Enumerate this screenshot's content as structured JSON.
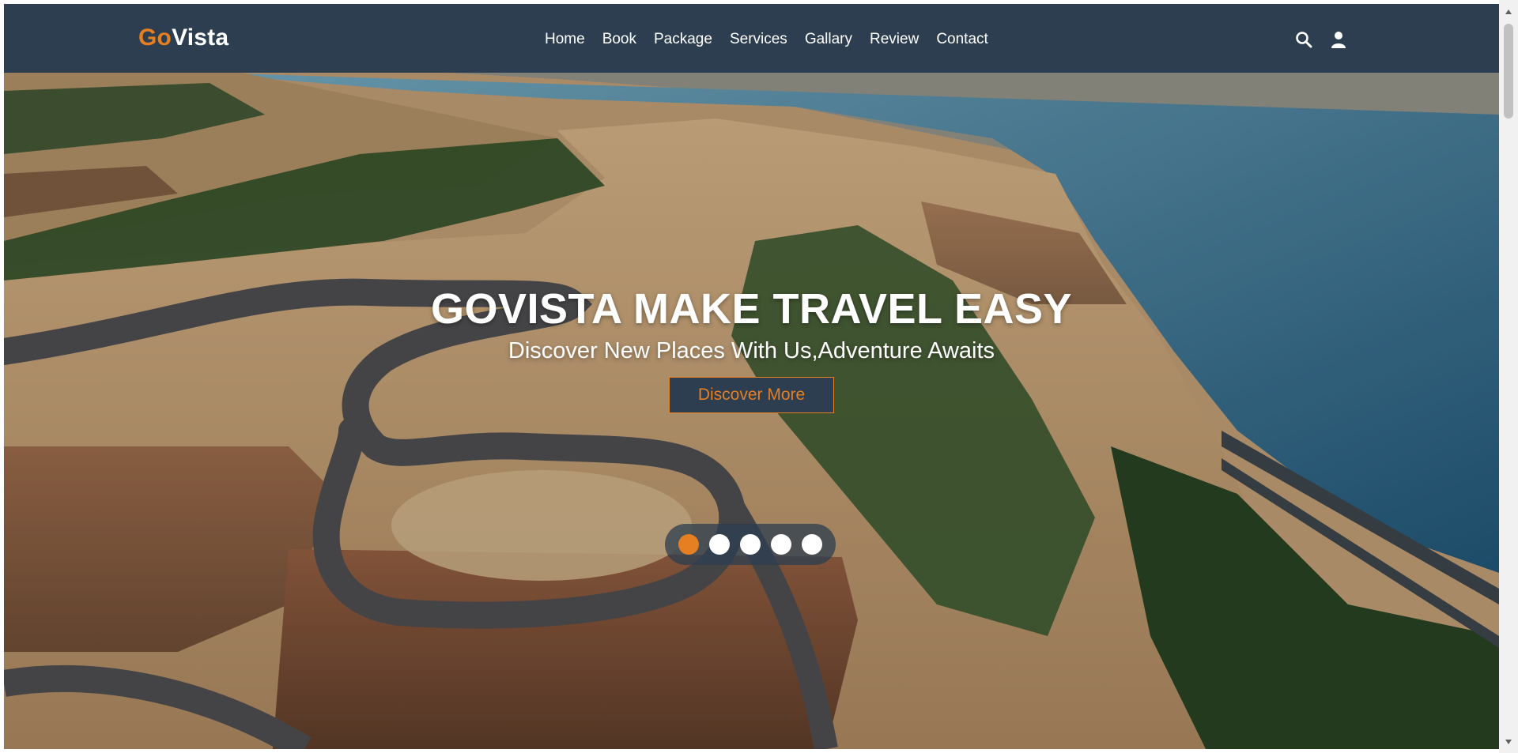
{
  "brand": {
    "logo_prefix": "Go",
    "logo_suffix": "Vista"
  },
  "nav": {
    "links": [
      {
        "label": "Home"
      },
      {
        "label": "Book"
      },
      {
        "label": "Package"
      },
      {
        "label": "Services"
      },
      {
        "label": "Gallary"
      },
      {
        "label": "Review"
      },
      {
        "label": "Contact"
      }
    ],
    "icons": [
      "search-icon",
      "user-icon"
    ]
  },
  "hero": {
    "title": "GOVISTA MAKE TRAVEL EASY",
    "subtitle": "Discover New Places With Us,Adventure Awaits",
    "cta_label": "Discover More"
  },
  "slider": {
    "active_index": 0,
    "dot_count": 5
  },
  "colors": {
    "navbar": "#2c3e50",
    "accent": "#e67e22",
    "text": "#ffffff"
  }
}
